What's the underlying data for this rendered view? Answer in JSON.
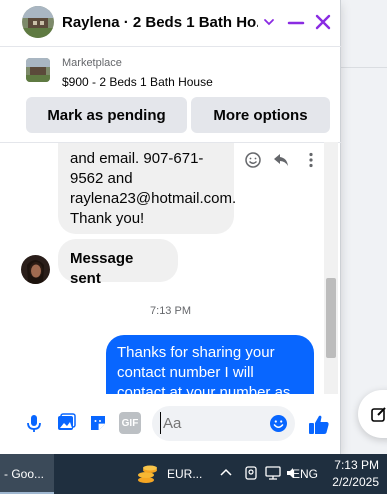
{
  "header": {
    "title": "Raylena · 2 Beds 1 Bath Ho...",
    "icons": [
      "house-photo",
      "chevron-down-icon",
      "minimize-icon",
      "close-icon"
    ]
  },
  "listing": {
    "source": "Marketplace",
    "title": "$900 - 2 Beds 1 Bath House"
  },
  "actions": {
    "pending_label": "Mark as pending",
    "more_label": "More options"
  },
  "thread": {
    "incoming_contact": "and email. 907-671-9562 and raylena23@hotmail.com. Thank you!",
    "incoming_sent": "Message sent",
    "timestamp": "7:13 PM",
    "outgoing": "Thanks for sharing your contact number I will contact at your number as"
  },
  "composer": {
    "placeholder": "Aa",
    "icons": [
      "microphone-icon",
      "image-icon",
      "sticker-icon",
      "gif-icon",
      "emoji-icon",
      "thumbs-up-icon"
    ],
    "gif_label": "GIF"
  },
  "taskbar": {
    "app_label": "- Goo...",
    "weather_label": "EUR...",
    "language": "ENG",
    "time": "7:13 PM",
    "date": "2/2/2025"
  },
  "colors": {
    "accent": "#0866ff",
    "header_icons": "#8a2be2",
    "taskbar": "#1f2f3f"
  }
}
